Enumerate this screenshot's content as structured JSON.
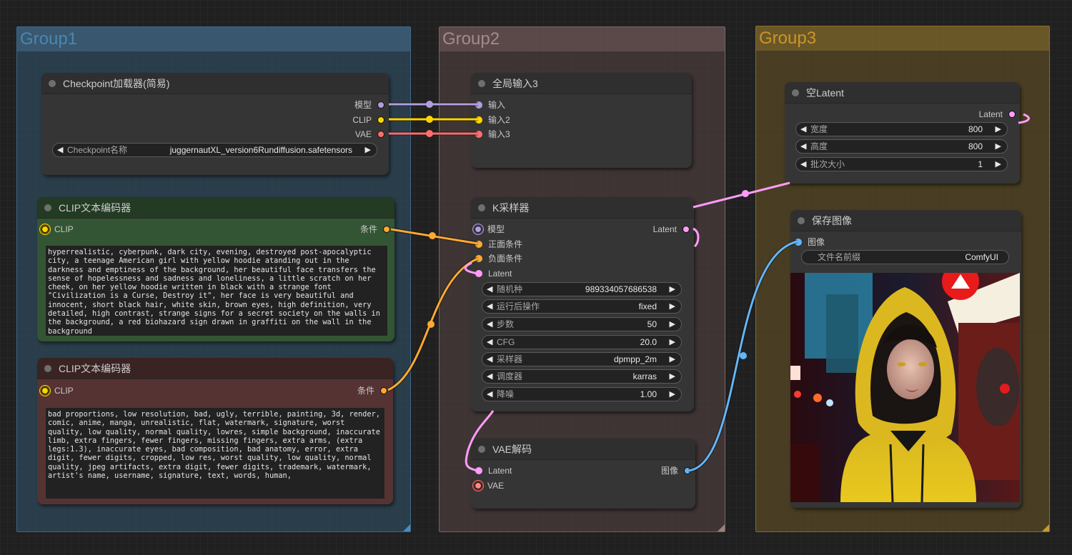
{
  "groups": [
    {
      "title": "Group1"
    },
    {
      "title": "Group2"
    },
    {
      "title": "Group3"
    }
  ],
  "colors": {
    "model": "#b39ddb",
    "clip": "#ffd500",
    "vae": "#ff6e6e",
    "conditioning": "#ffa931",
    "latent": "#ff9cf9",
    "image": "#64b5f6"
  },
  "nodes": {
    "checkpoint_loader": {
      "title": "Checkpoint加载器(简易)",
      "outputs": [
        "模型",
        "CLIP",
        "VAE"
      ],
      "widgets": [
        {
          "label": "Checkpoint名称",
          "value": "juggernautXL_version6Rundiffusion.safetensors"
        }
      ]
    },
    "clip_positive": {
      "title": "CLIP文本编码器",
      "input": "CLIP",
      "output": "条件",
      "text": "hyperrealistic, cyberpunk, dark city, evening, destroyed post-apocalyptic city, a teenage American girl with yellow hoodie atanding out in the darkness and emptiness of the background, her beautiful face transfers the sense of hopelessness and sadness and loneliness, a little scratch on her cheek, on her yellow hoodie written in black with a strange font \"Civilization is a Curse, Destroy it\", her face is very beautiful and innocent, short black hair, white skin, brown eyes, high definition, very detailed, high contrast, strange signs for a secret society on the walls in the background, a red biohazard sign drawn in graffiti on the wall in the background"
    },
    "clip_negative": {
      "title": "CLIP文本编码器",
      "input": "CLIP",
      "output": "条件",
      "text": "bad proportions, low resolution, bad, ugly, terrible, painting, 3d, render, comic, anime, manga, unrealistic, flat, watermark, signature, worst quality, low quality, normal quality, lowres, simple background, inaccurate limb, extra fingers, fewer fingers, missing fingers, extra arms, (extra legs:1.3), inaccurate eyes, bad composition, bad anatomy, error, extra digit, fewer digits, cropped, low res, worst quality, low quality, normal quality, jpeg artifacts, extra digit, fewer digits, trademark, watermark, artist's name, username, signature, text, words, human,"
    },
    "global_input": {
      "title": "全局输入3",
      "inputs": [
        "输入",
        "输入2",
        "输入3"
      ]
    },
    "ksampler": {
      "title": "K采样器",
      "inputs": [
        "模型",
        "正面条件",
        "负面条件",
        "Latent"
      ],
      "output": "Latent",
      "widgets": [
        {
          "label": "随机种",
          "value": "989334057686538"
        },
        {
          "label": "运行后操作",
          "value": "fixed"
        },
        {
          "label": "步数",
          "value": "50"
        },
        {
          "label": "CFG",
          "value": "20.0"
        },
        {
          "label": "采样器",
          "value": "dpmpp_2m"
        },
        {
          "label": "调度器",
          "value": "karras"
        },
        {
          "label": "降噪",
          "value": "1.00"
        }
      ]
    },
    "vae_decode": {
      "title": "VAE解码",
      "inputs": [
        "Latent",
        "VAE"
      ],
      "output": "图像"
    },
    "empty_latent": {
      "title": "空Latent",
      "output": "Latent",
      "widgets": [
        {
          "label": "宽度",
          "value": "800"
        },
        {
          "label": "高度",
          "value": "800"
        },
        {
          "label": "批次大小",
          "value": "1"
        }
      ]
    },
    "save_image": {
      "title": "保存图像",
      "input": "图像",
      "widgets": [
        {
          "label": "文件名前缀",
          "value": "ComfyUI"
        }
      ],
      "preview_alt": "Generated image: girl in yellow hoodie in cyberpunk city"
    }
  },
  "icons": {
    "arrow_left": "◀",
    "arrow_right": "▶"
  }
}
